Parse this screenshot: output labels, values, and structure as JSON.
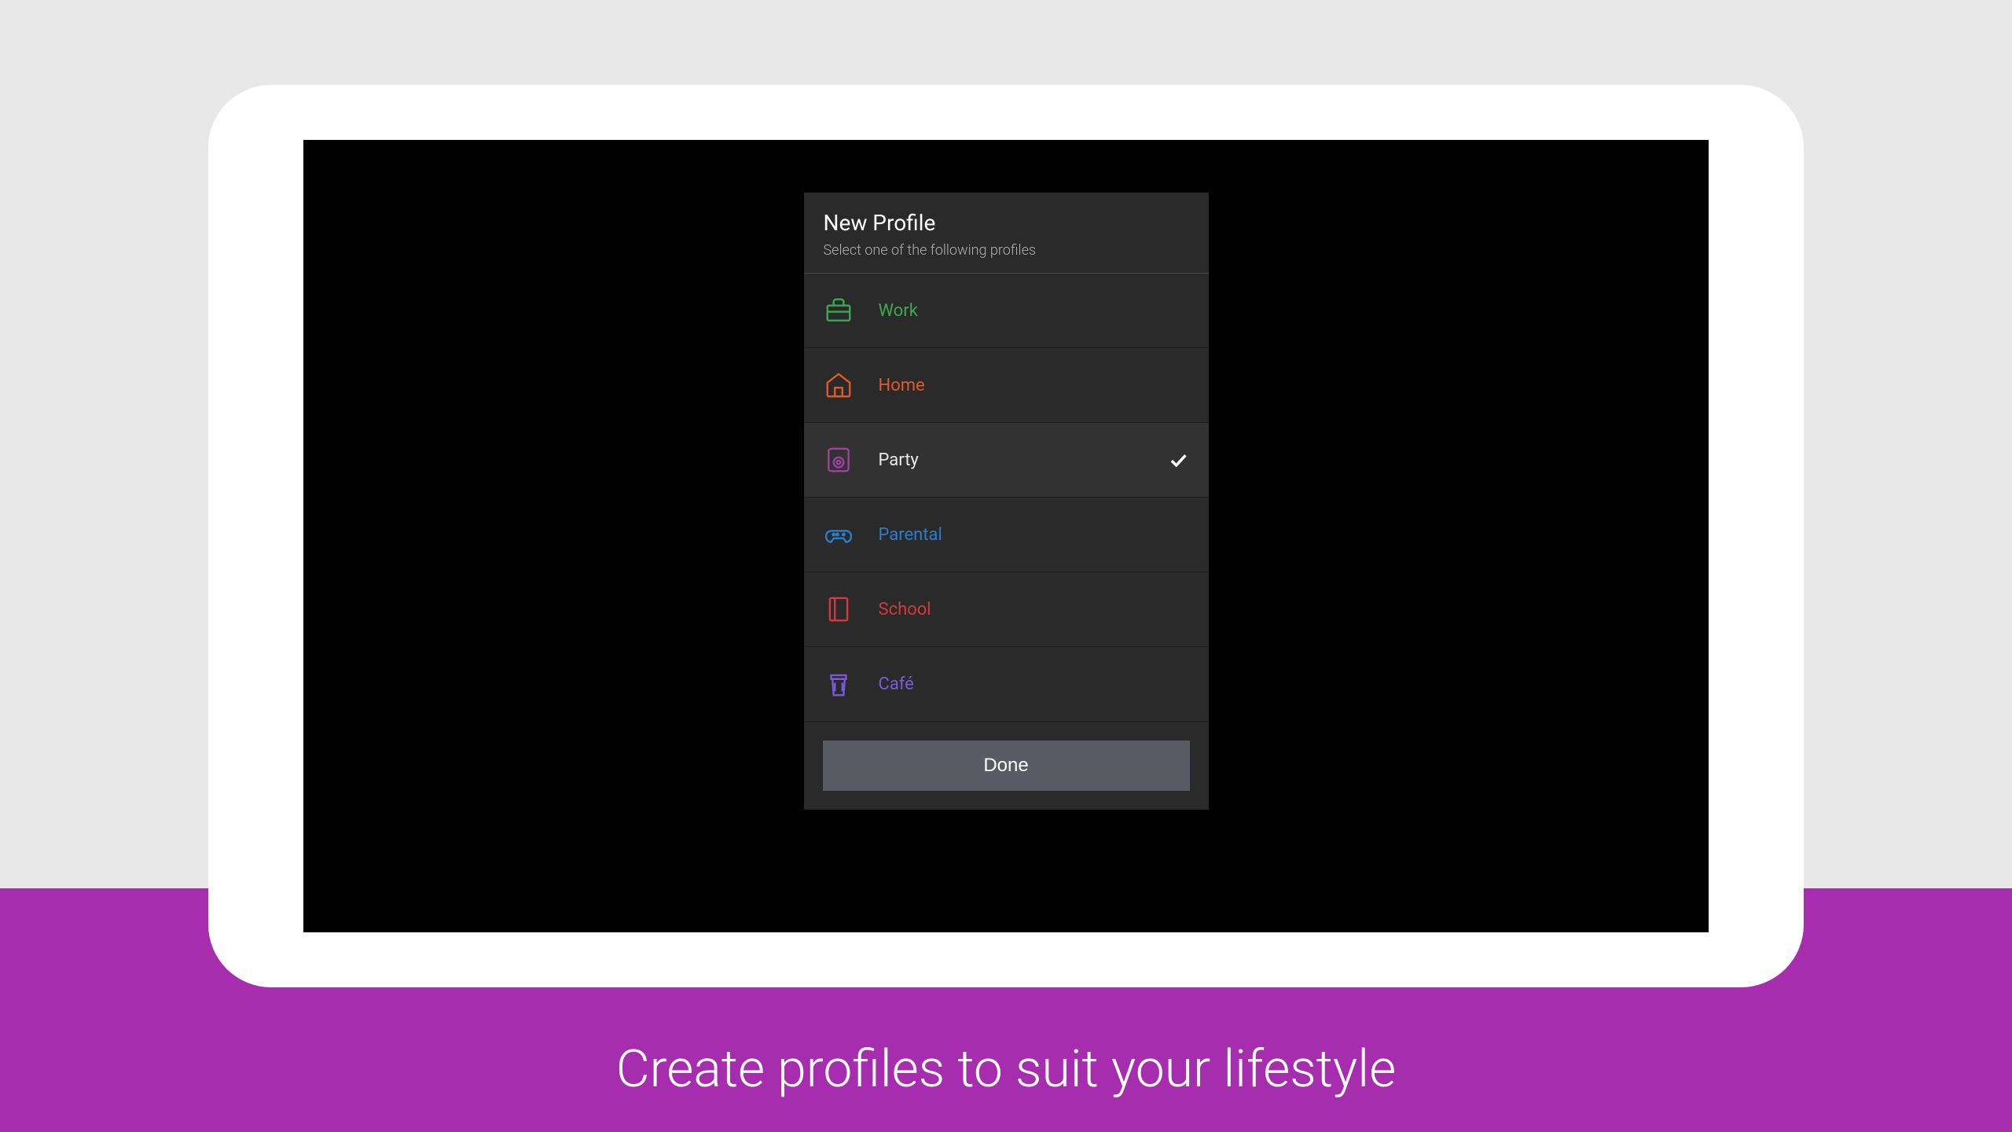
{
  "banner": {
    "text": "Create profiles to suit your lifestyle"
  },
  "dialog": {
    "title": "New Profile",
    "subtitle": "Select one of the following profiles",
    "done_label": "Done"
  },
  "profiles": [
    {
      "label": "Work",
      "color": "green",
      "selected": false
    },
    {
      "label": "Home",
      "color": "orange",
      "selected": false
    },
    {
      "label": "Party",
      "color": "purple",
      "selected": true
    },
    {
      "label": "Parental",
      "color": "blue",
      "selected": false
    },
    {
      "label": "School",
      "color": "red",
      "selected": false
    },
    {
      "label": "Café",
      "color": "violet",
      "selected": false
    }
  ]
}
